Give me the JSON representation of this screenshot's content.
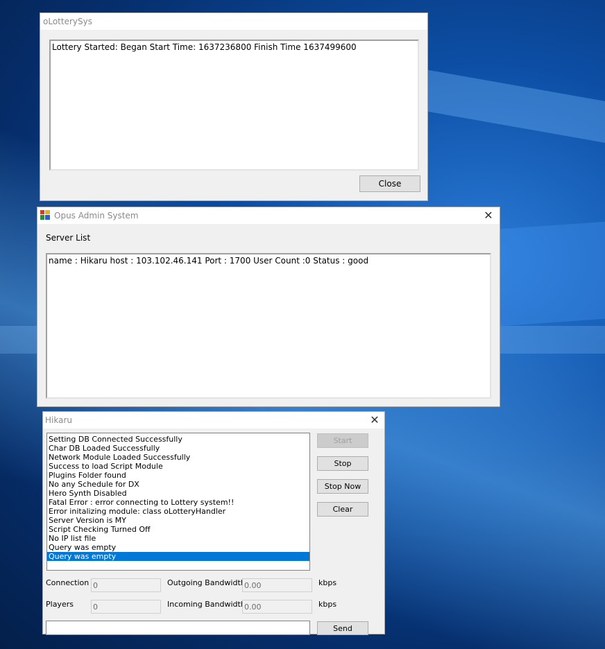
{
  "lottery_window": {
    "title": "oLotterySys",
    "message": "Lottery Started: Began Start Time: 1637236800 Finish Time 1637499600",
    "close_label": "Close"
  },
  "admin_window": {
    "title": "Opus Admin System",
    "close_symbol": "✕",
    "server_list_label": "Server List",
    "server_entry": "name : Hikaru host : 103.102.46.141 Port : 1700 User Count :0 Status : good"
  },
  "server_window": {
    "title": "Hikaru",
    "close_symbol": "✕",
    "log": [
      "Setting DB Connected Successfully",
      "Char DB Loaded Successfully",
      "Network Module Loaded Successfully",
      "Success to load Script Module",
      "Plugins Folder found",
      "No any Schedule for DX",
      "Hero Synth Disabled",
      "Fatal Error : error connecting to Lottery system!!",
      "Error initalizing module: class oLotteryHandler",
      "Server Version is MY",
      "Script Checking Turned Off",
      "No IP list file",
      "Query was empty",
      "Query was empty"
    ],
    "selected_index": 13,
    "buttons": {
      "start": "Start",
      "stop": "Stop",
      "stop_now": "Stop Now",
      "clear": "Clear",
      "send": "Send"
    },
    "stats": {
      "connection_label": "Connection",
      "connection_value": "0",
      "players_label": "Players",
      "players_value": "0",
      "outgoing_label": "Outgoing Bandwidth",
      "outgoing_value": "0.00",
      "incoming_label": "Incoming Bandwidth",
      "incoming_value": "0.00",
      "unit_out": "kbps",
      "unit_in": "kbps"
    },
    "command_value": ""
  },
  "colors": {
    "selection": "#0078d7",
    "window_bg": "#f0f0f0",
    "desktop": "#0d4fa6"
  }
}
